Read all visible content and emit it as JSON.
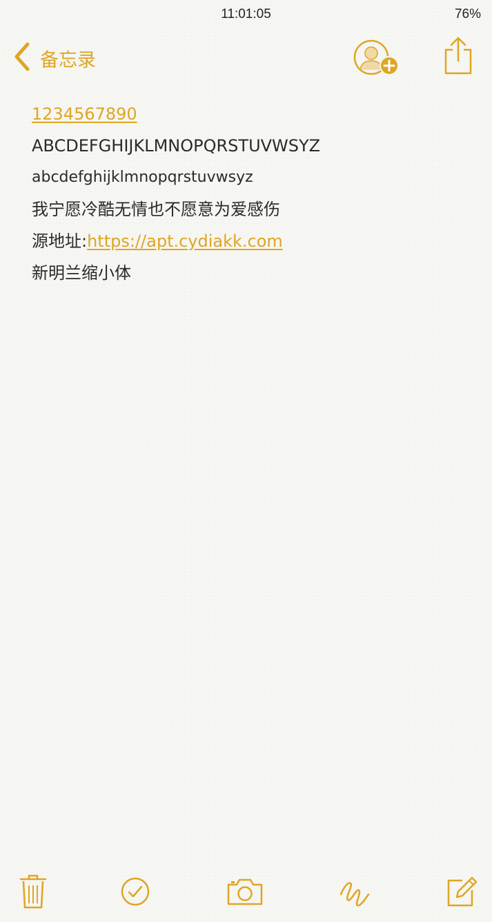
{
  "status_bar": {
    "time": "11:01:05",
    "battery": "76%"
  },
  "nav": {
    "back_label": "备忘录",
    "icons": {
      "back": "chevron-left-icon",
      "add_person": "add-person-icon",
      "share": "share-icon"
    }
  },
  "note": {
    "lines": [
      {
        "text": "1234567890",
        "type": "link"
      },
      {
        "text": "ABCDEFGHIJKLMNOPQRSTUVWSYZ",
        "type": "text"
      },
      {
        "text": "abcdefghijklmnopqrstuvwsyz",
        "type": "text"
      },
      {
        "text": "我宁愿冷酷无情也不愿意为爱感伤",
        "type": "text"
      },
      {
        "prefix": "源地址:",
        "link": "https://apt.cydiakk.com",
        "type": "mixed"
      },
      {
        "text": "新明兰缩小体",
        "type": "text"
      }
    ]
  },
  "toolbar": {
    "icons": [
      "trash-icon",
      "checklist-icon",
      "camera-icon",
      "sketch-icon",
      "compose-icon"
    ]
  },
  "colors": {
    "accent": "#dea622",
    "text": "#2a2a2a",
    "background": "#f6f6f3"
  }
}
